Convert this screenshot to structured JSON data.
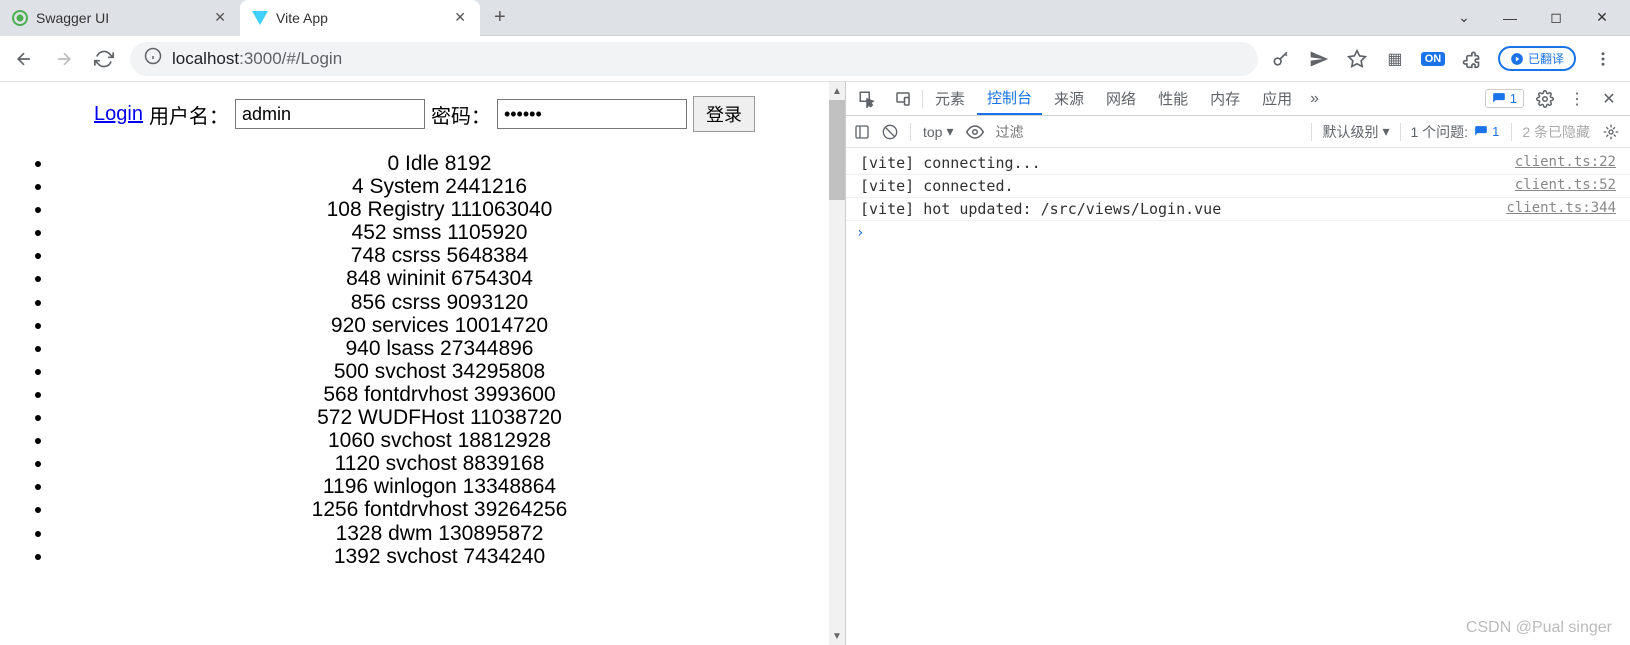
{
  "browser": {
    "tabs": [
      {
        "title": "Swagger UI",
        "active": false
      },
      {
        "title": "Vite App",
        "active": true
      }
    ],
    "url_host": "localhost",
    "url_path": ":3000/#/Login",
    "translate_label": "已翻译"
  },
  "page": {
    "login_link": "Login",
    "username_label": "用户名：",
    "username_value": "admin",
    "password_label": "密码：",
    "password_value": "••••••",
    "submit_label": "登录",
    "processes": [
      "0 Idle 8192",
      "4 System 2441216",
      "108 Registry 111063040",
      "452 smss 1105920",
      "748 csrss 5648384",
      "848 wininit 6754304",
      "856 csrss 9093120",
      "920 services 10014720",
      "940 lsass 27344896",
      "500 svchost 34295808",
      "568 fontdrvhost 3993600",
      "572 WUDFHost 11038720",
      "1060 svchost 18812928",
      "1120 svchost 8839168",
      "1196 winlogon 13348864",
      "1256 fontdrvhost 39264256",
      "1328 dwm 130895872",
      "1392 svchost 7434240"
    ]
  },
  "devtools": {
    "tabs": [
      "元素",
      "控制台",
      "来源",
      "网络",
      "性能",
      "内存",
      "应用"
    ],
    "active_tab": "控制台",
    "badge_count": "1",
    "toolbar": {
      "context": "top",
      "filter_placeholder": "过滤",
      "level": "默认级别",
      "issues_label": "1 个问题:",
      "issues_count": "1",
      "hidden_label": "2 条已隐藏"
    },
    "console": [
      {
        "msg": "[vite] connecting...",
        "src": "client.ts:22"
      },
      {
        "msg": "[vite] connected.",
        "src": "client.ts:52"
      },
      {
        "msg": "[vite] hot updated: /src/views/Login.vue",
        "src": "client.ts:344"
      }
    ]
  },
  "watermark": "CSDN @Pual singer"
}
